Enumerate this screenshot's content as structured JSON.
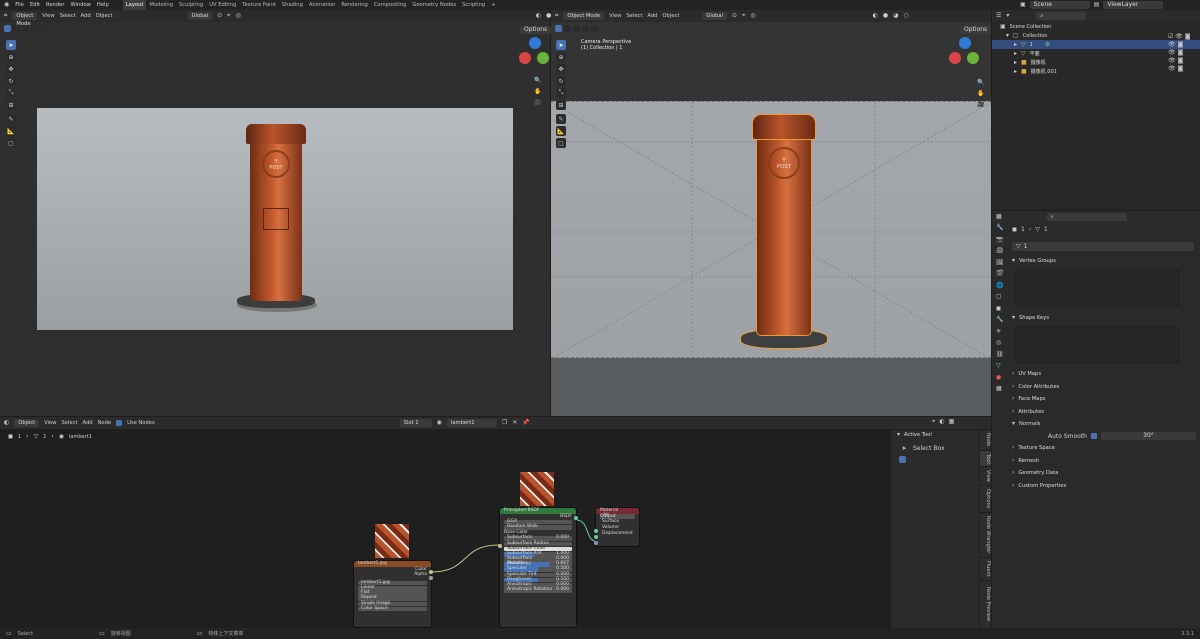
{
  "topbar": {
    "menus": [
      "File",
      "Edit",
      "Render",
      "Window",
      "Help"
    ],
    "workspaces": [
      "Layout",
      "Modeling",
      "Sculpting",
      "UV Editing",
      "Texture Paint",
      "Shading",
      "Animation",
      "Rendering",
      "Compositing",
      "Geometry Nodes",
      "Scripting"
    ],
    "active_workspace": "Layout",
    "add_tab": "+",
    "scene": "Scene",
    "view_layer": "ViewLayer"
  },
  "viewport_left": {
    "mode": "Object Mode",
    "menus": [
      "View",
      "Select",
      "Add",
      "Object"
    ],
    "orientation": "Global",
    "options": "Options"
  },
  "viewport_right": {
    "mode": "Object Mode",
    "menus": [
      "View",
      "Select",
      "Add",
      "Object"
    ],
    "orientation": "Global",
    "options": "Options",
    "overlay_title": "Camera Perspective",
    "overlay_sub": "(1) Collection | 1"
  },
  "postbox": {
    "label": "POST",
    "glyph": "〒"
  },
  "outliner": {
    "root": "Scene Collection",
    "collection": "Collection",
    "items": [
      "1",
      "平面",
      "摄像机",
      "摄像机.001"
    ]
  },
  "properties": {
    "breadcrumb_obj": "1",
    "breadcrumb_mesh": "1",
    "mesh_name": "1",
    "vertex_groups": "Vertex Groups",
    "shape_keys": "Shape Keys",
    "sections": [
      "UV Maps",
      "Color Attributes",
      "Face Maps",
      "Attributes",
      "Normals"
    ],
    "auto_smooth_label": "Auto Smooth",
    "auto_smooth_value": "30°",
    "sections2": [
      "Texture Space",
      "Remesh",
      "Geometry Data",
      "Custom Properties"
    ]
  },
  "node_editor": {
    "mode": "Object",
    "menus": [
      "View",
      "Select",
      "Add",
      "Node"
    ],
    "use_nodes": "Use Nodes",
    "slot": "Slot 1",
    "material": "lambert1",
    "breadcrumb": [
      "1",
      "1",
      "lambert1"
    ],
    "sidebar_tabs": [
      "Node",
      "Tool",
      "View",
      "Options",
      "Node Wrangler",
      "Fluent",
      "Node Preview"
    ],
    "active_tool_title": "Active Tool",
    "active_tool_name": "Select Box"
  },
  "image_node": {
    "title": "lambert1.jpg",
    "outputs": [
      "Color",
      "Alpha"
    ],
    "image": "lambert1.jpg",
    "fields": [
      "Linear",
      "Flat",
      "Repeat",
      "Single Image",
      "Color Space",
      "Alpha"
    ]
  },
  "bsdf_node": {
    "title": "Principled BSDF",
    "output": "BSDF",
    "dist": "GGX",
    "sss_method": "Random Walk",
    "base_color": "Base Color",
    "fields": [
      {
        "label": "Subsurface",
        "value": "0.000",
        "fill": 0
      },
      {
        "label": "Subsurface Radius",
        "value": "",
        "fill": 0
      },
      {
        "label": "Subsurface Color",
        "value": "",
        "fill": 0
      },
      {
        "label": "Subsurface IOR",
        "value": "1.400",
        "fill": 0.45
      },
      {
        "label": "Subsurface Anisotropy",
        "value": "0.000",
        "fill": 0
      },
      {
        "label": "Metallic",
        "value": "0.667",
        "fill": 0.67
      },
      {
        "label": "Specular",
        "value": "0.500",
        "fill": 0.5
      },
      {
        "label": "Specular Tint",
        "value": "0.000",
        "fill": 0
      },
      {
        "label": "Roughness",
        "value": "0.500",
        "fill": 0.5
      },
      {
        "label": "Anisotropic",
        "value": "0.000",
        "fill": 0
      },
      {
        "label": "Anisotropic Rotation",
        "value": "0.000",
        "fill": 0
      }
    ]
  },
  "output_node": {
    "title": "Material Output",
    "target": "All",
    "inputs": [
      "Surface",
      "Volume",
      "Displacement"
    ]
  },
  "statusbar": {
    "left": "Select",
    "mid1": "旋转视图",
    "mid2": "物体上下文菜单",
    "version": "3.3.1"
  },
  "colors": {
    "accent": "#4772b3",
    "orange": "#b9542a",
    "bg": "#1d1d1d",
    "header": "#2b2b2b"
  }
}
